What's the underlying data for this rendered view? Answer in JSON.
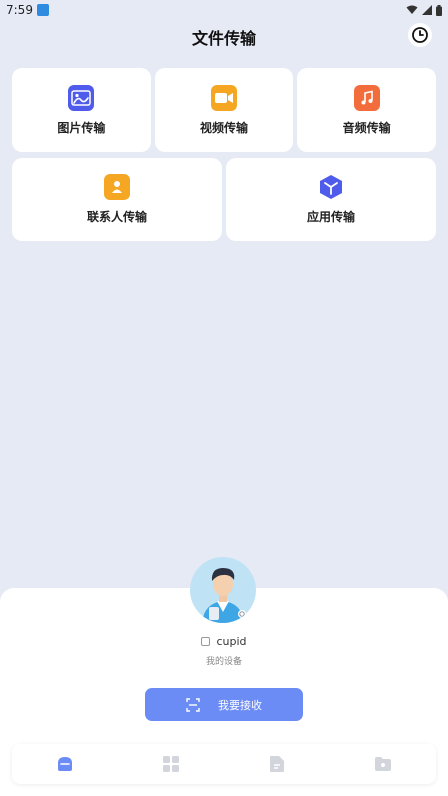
{
  "status_bar": {
    "time": "7:59"
  },
  "header": {
    "title": "文件传输"
  },
  "tiles_row1": [
    {
      "label": "图片传输",
      "icon": "image-icon",
      "color": "#4f5bea"
    },
    {
      "label": "视频传输",
      "icon": "video-icon",
      "color": "#f5a623"
    },
    {
      "label": "音频传输",
      "icon": "music-icon",
      "color": "#f36c3b"
    }
  ],
  "tiles_row2": [
    {
      "label": "联系人传输",
      "icon": "contact-icon",
      "color": "#f5a623"
    },
    {
      "label": "应用传输",
      "icon": "app-cube-icon",
      "color": "#4f5bea"
    }
  ],
  "device": {
    "name": "cupid",
    "subtitle": "我的设备"
  },
  "receive_button": {
    "label": "我要接收"
  },
  "tabbar": {
    "tabs": [
      {
        "icon": "transfer-tab-icon",
        "active": true
      },
      {
        "icon": "grid-tab-icon",
        "active": false
      },
      {
        "icon": "file-tab-icon",
        "active": false
      },
      {
        "icon": "folder-tab-icon",
        "active": false
      }
    ]
  }
}
